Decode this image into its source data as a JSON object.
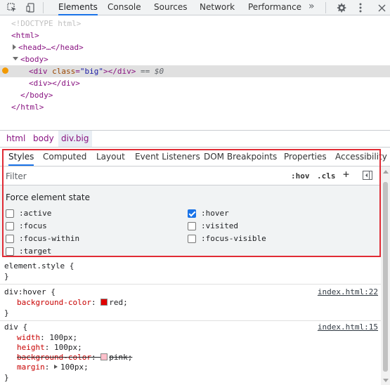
{
  "toolbar": {
    "tabs": [
      "Elements",
      "Console",
      "Sources",
      "Network",
      "Performance"
    ],
    "more_label": "»"
  },
  "tree": {
    "doctype": "<!DOCTYPE html>",
    "html_open": "<html>",
    "head": "<head>…</head>",
    "body_open": "<body>",
    "div_open_tag": "<div ",
    "div_attr": "class",
    "div_eq": "=",
    "div_val": "\"big\"",
    "div_close": "></div>",
    "div_suffix": " == $0",
    "div2": "<div></div>",
    "body_close": "</body>",
    "html_close": "</html>"
  },
  "breadcrumb": [
    "html",
    "body",
    "div.big"
  ],
  "panel_tabs": [
    "Styles",
    "Computed",
    "Layout",
    "Event Listeners",
    "DOM Breakpoints",
    "Properties",
    "Accessibility"
  ],
  "filter": {
    "placeholder": "Filter",
    "hov": ":hov",
    "cls": ".cls",
    "plus": "+"
  },
  "force_state": {
    "title": "Force element state",
    "left": [
      {
        "label": ":active",
        "checked": false
      },
      {
        "label": ":focus",
        "checked": false
      },
      {
        "label": ":focus-within",
        "checked": false
      },
      {
        "label": ":target",
        "checked": false
      }
    ],
    "right": [
      {
        "label": ":hover",
        "checked": true
      },
      {
        "label": ":visited",
        "checked": false
      },
      {
        "label": ":focus-visible",
        "checked": false
      }
    ]
  },
  "rules": {
    "element_style": {
      "selector": "element.style {",
      "close": "}"
    },
    "hover_rule": {
      "selector": "div:hover {",
      "source": "index.html:22",
      "prop": "background-color",
      "value": "red;",
      "swatch": "#e00000",
      "close": "}"
    },
    "div_rule": {
      "selector": "div {",
      "source": "index.html:15",
      "width_prop": "width",
      "width_val": "100px;",
      "height_prop": "height",
      "height_val": "100px;",
      "bg_prop": "background-color",
      "bg_val": "pink;",
      "bg_swatch": "#ffc0cb",
      "margin_prop": "margin",
      "margin_val": "100px;",
      "close": "}"
    }
  },
  "colors": {
    "accent": "#1a73e8",
    "highlight_border": "#e02b35",
    "dom_marker": "#f29900"
  }
}
